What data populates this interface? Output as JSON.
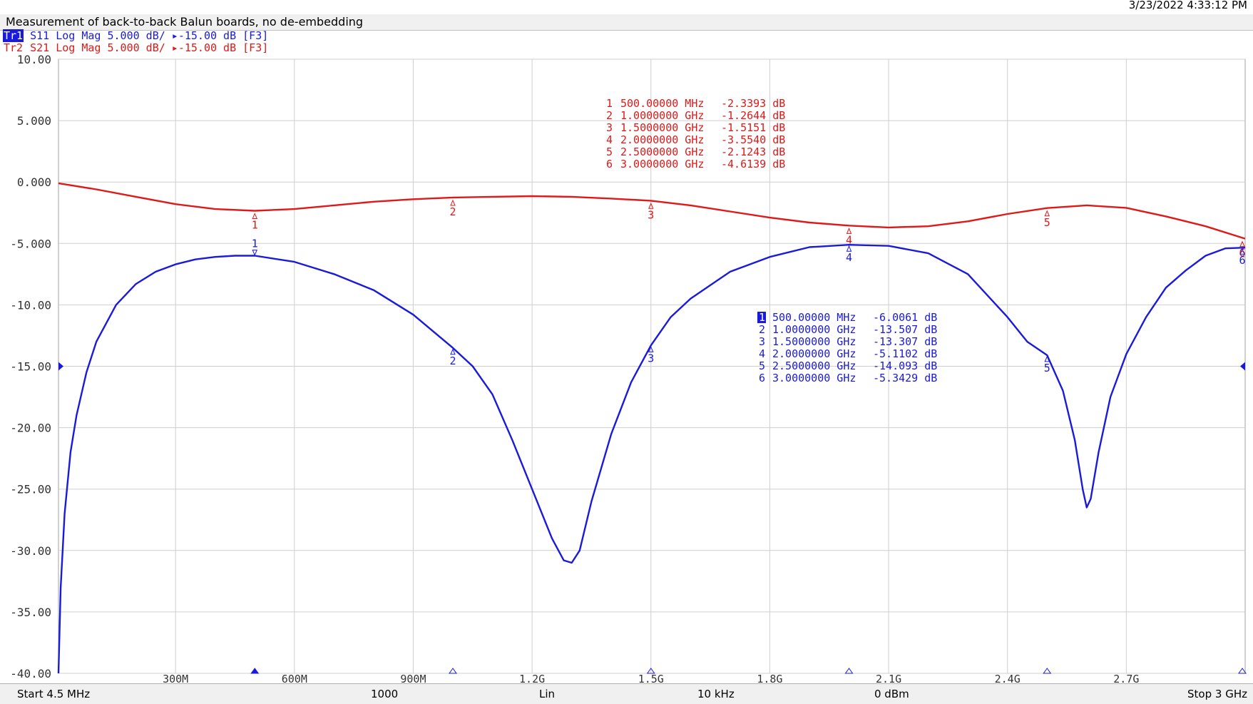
{
  "timestamp": "3/23/2022 4:33:12 PM",
  "title": "Measurement of back-to-back Balun boards, no de-embedding",
  "traces": [
    {
      "tag": "Tr1",
      "text": " S11 Log Mag 5.000 dB/ ▸-15.00 dB [F3]",
      "color": "#1a1adc"
    },
    {
      "tag": "Tr2",
      "text": " S21 Log Mag 5.000 dB/ ▸-15.00 dB [F3]",
      "color": "#e01818"
    }
  ],
  "footer": {
    "start": "Start 4.5 MHz",
    "points": "1000",
    "sweep": "Lin",
    "ifbw": "10 kHz",
    "power": "0 dBm",
    "stop": "Stop 3 GHz"
  },
  "chart_data": {
    "type": "line",
    "xlabel": "",
    "ylabel": "",
    "xlim": [
      4.5,
      3000
    ],
    "ylim": [
      -40,
      10
    ],
    "x_unit": "MHz",
    "y_tick_labels": [
      "10.00",
      "5.000",
      "0.000",
      "-5.000",
      "-10.00",
      "-15.00",
      "-20.00",
      "-25.00",
      "-30.00",
      "-35.00",
      "-40.00"
    ],
    "y_ticks": [
      10,
      5,
      0,
      -5,
      -10,
      -15,
      -20,
      -25,
      -30,
      -35,
      -40
    ],
    "x_ticks": [
      300,
      600,
      900,
      1200,
      1500,
      1800,
      2100,
      2400,
      2700
    ],
    "x_tick_labels": [
      "300M",
      "600M",
      "900M",
      "1.2G",
      "1.5G",
      "1.8G",
      "2.1G",
      "2.4G",
      "2.7G"
    ],
    "reference_level": -15,
    "grid": true,
    "series": [
      {
        "name": "S21",
        "color": "#e01818",
        "x": [
          4.5,
          100,
          200,
          300,
          400,
          500,
          600,
          700,
          800,
          900,
          1000,
          1100,
          1200,
          1300,
          1400,
          1500,
          1600,
          1700,
          1800,
          1900,
          2000,
          2100,
          2200,
          2300,
          2400,
          2500,
          2600,
          2700,
          2800,
          2900,
          3000
        ],
        "y": [
          -0.1,
          -0.6,
          -1.2,
          -1.8,
          -2.2,
          -2.34,
          -2.2,
          -1.9,
          -1.6,
          -1.4,
          -1.26,
          -1.2,
          -1.15,
          -1.2,
          -1.35,
          -1.52,
          -1.9,
          -2.4,
          -2.9,
          -3.3,
          -3.55,
          -3.7,
          -3.6,
          -3.2,
          -2.6,
          -2.12,
          -1.9,
          -2.1,
          -2.8,
          -3.6,
          -4.61
        ],
        "markers": [
          {
            "id": "1",
            "freq": "500.00000 MHz",
            "value": "-2.3393 dB",
            "x": 500,
            "y": -2.3393
          },
          {
            "id": "2",
            "freq": "1.0000000 GHz",
            "value": "-1.2644 dB",
            "x": 1000,
            "y": -1.2644
          },
          {
            "id": "3",
            "freq": "1.5000000 GHz",
            "value": "-1.5151 dB",
            "x": 1500,
            "y": -1.5151
          },
          {
            "id": "4",
            "freq": "2.0000000 GHz",
            "value": "-3.5540 dB",
            "x": 2000,
            "y": -3.554
          },
          {
            "id": "5",
            "freq": "2.5000000 GHz",
            "value": "-2.1243 dB",
            "x": 2500,
            "y": -2.1243
          },
          {
            "id": "6",
            "freq": "3.0000000 GHz",
            "value": "-4.6139 dB",
            "x": 3000,
            "y": -4.6139
          }
        ]
      },
      {
        "name": "S11",
        "color": "#1a1adc",
        "x": [
          4.5,
          10,
          20,
          35,
          50,
          75,
          100,
          150,
          200,
          250,
          300,
          350,
          400,
          450,
          500,
          600,
          700,
          800,
          900,
          1000,
          1050,
          1100,
          1150,
          1200,
          1250,
          1280,
          1300,
          1320,
          1350,
          1400,
          1450,
          1500,
          1550,
          1600,
          1700,
          1800,
          1900,
          2000,
          2100,
          2200,
          2300,
          2400,
          2450,
          2500,
          2540,
          2570,
          2590,
          2600,
          2610,
          2630,
          2660,
          2700,
          2750,
          2800,
          2850,
          2900,
          2950,
          3000
        ],
        "y": [
          -40,
          -33,
          -27,
          -22,
          -19,
          -15.5,
          -13,
          -10,
          -8.3,
          -7.3,
          -6.7,
          -6.3,
          -6.1,
          -6.0,
          -6.0,
          -6.5,
          -7.5,
          -8.8,
          -10.8,
          -13.5,
          -15.0,
          -17.3,
          -21.0,
          -25.0,
          -29.0,
          -30.8,
          -31.0,
          -30.0,
          -26.0,
          -20.5,
          -16.3,
          -13.3,
          -11.0,
          -9.5,
          -7.3,
          -6.1,
          -5.3,
          -5.11,
          -5.2,
          -5.8,
          -7.5,
          -11.0,
          -13.0,
          -14.1,
          -17.0,
          -21.0,
          -25.0,
          -26.5,
          -25.8,
          -22.0,
          -17.5,
          -14.0,
          -11.0,
          -8.6,
          -7.2,
          -6.0,
          -5.4,
          -5.34
        ],
        "markers": [
          {
            "id": "1",
            "freq": "500.00000 MHz",
            "value": "-6.0061 dB",
            "x": 500,
            "y": -6.0061
          },
          {
            "id": "2",
            "freq": "1.0000000 GHz",
            "value": "-13.507 dB",
            "x": 1000,
            "y": -13.507
          },
          {
            "id": "3",
            "freq": "1.5000000 GHz",
            "value": "-13.307 dB",
            "x": 1500,
            "y": -13.307
          },
          {
            "id": "4",
            "freq": "2.0000000 GHz",
            "value": "-5.1102 dB",
            "x": 2000,
            "y": -5.1102
          },
          {
            "id": "5",
            "freq": "2.5000000 GHz",
            "value": "-14.093 dB",
            "x": 2500,
            "y": -14.093
          },
          {
            "id": "6",
            "freq": "3.0000000 GHz",
            "value": "-5.3429 dB",
            "x": 3000,
            "y": -5.3429
          }
        ]
      }
    ]
  }
}
